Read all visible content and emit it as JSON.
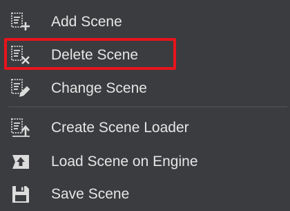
{
  "menu": {
    "items": [
      {
        "label": "Add Scene",
        "icon": "add-scene-icon"
      },
      {
        "label": "Delete Scene",
        "icon": "delete-scene-icon"
      },
      {
        "label": "Change Scene",
        "icon": "change-scene-icon"
      },
      {
        "label": "Create Scene Loader",
        "icon": "create-scene-loader-icon"
      },
      {
        "label": "Load Scene on Engine",
        "icon": "load-scene-on-engine-icon"
      },
      {
        "label": "Save Scene",
        "icon": "save-scene-icon"
      }
    ],
    "highlighted_item": "Delete Scene"
  },
  "colors": {
    "background": "#3b3c3f",
    "text": "#e6e6e6",
    "icon": "#dcdcdc",
    "highlight_border": "#e8141b",
    "separator": "#55575b"
  }
}
